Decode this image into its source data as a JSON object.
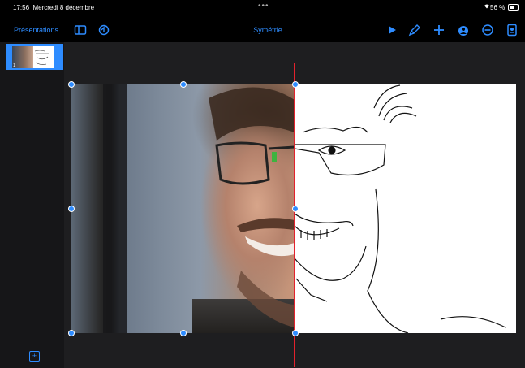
{
  "status_bar": {
    "time": "17:56",
    "date": "Mercredi 8 décembre",
    "dots": "•••",
    "battery": "56 %"
  },
  "toolbar": {
    "back_label": "Présentations",
    "title": "Symétrie",
    "icons": [
      "sidebar-icon",
      "undo-icon",
      "play-icon",
      "brush-icon",
      "add-icon",
      "share-icon",
      "more-icon",
      "document-icon"
    ]
  },
  "sidebar": {
    "slides": [
      {
        "number": "1"
      }
    ],
    "add_label": "+"
  },
  "colors": {
    "accent": "#2e8cff",
    "guide": "#e3222d",
    "background": "#000000",
    "canvas": "#1e1e20"
  }
}
